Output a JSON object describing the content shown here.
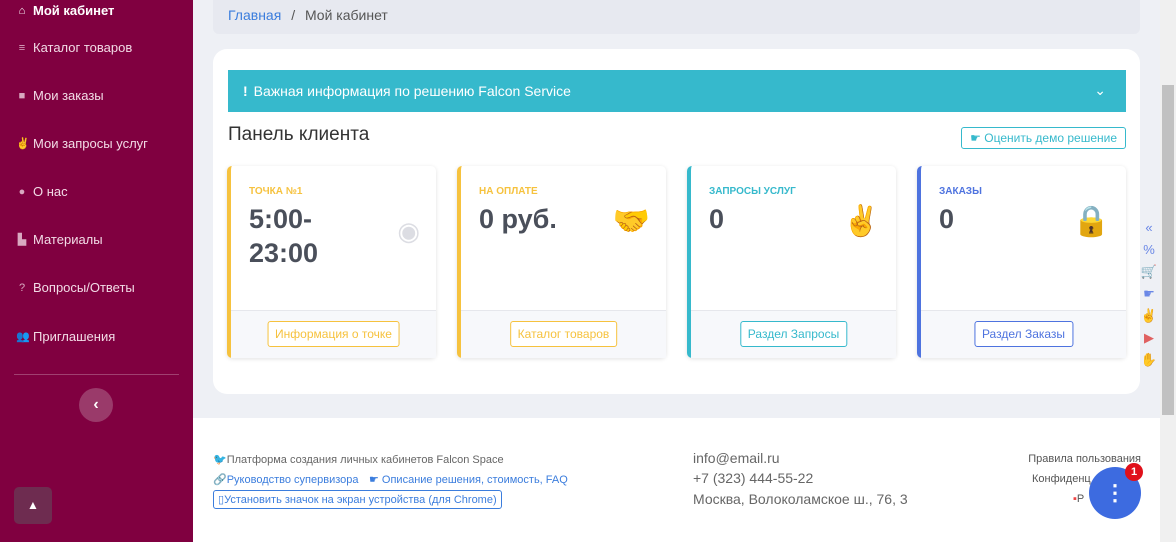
{
  "sidebar": {
    "items": [
      {
        "label": "Мой кабинет",
        "icon": "home-icon"
      },
      {
        "label": "Каталог товаров",
        "icon": "list-icon"
      },
      {
        "label": "Мои заказы",
        "icon": "bag-icon"
      },
      {
        "label": "Мои запросы услуг",
        "icon": "hand-peace-icon"
      },
      {
        "label": "О нас",
        "icon": "info-icon"
      },
      {
        "label": "Материалы",
        "icon": "materials-icon"
      },
      {
        "label": "Вопросы/Ответы",
        "icon": "question-icon"
      },
      {
        "label": "Приглашения",
        "icon": "users-icon"
      }
    ]
  },
  "breadcrumb": {
    "home": "Главная",
    "sep": "/",
    "current": "Мой кабинет"
  },
  "alert": {
    "text": "Важная информация по решению Falcon Service"
  },
  "panel": {
    "title": "Панель клиента",
    "rate_button": "Оценить демо решение"
  },
  "cards": [
    {
      "label": "ТОЧКА №1",
      "value": "5:00-23:00",
      "button": "Информация о точке",
      "color": "#f6c23e"
    },
    {
      "label": "НА ОПЛАТЕ",
      "value": "0 руб.",
      "button": "Каталог товаров",
      "color": "#f6c23e"
    },
    {
      "label": "ЗАПРОСЫ УСЛУГ",
      "value": "0",
      "button": "Раздел Запросы",
      "color": "#36b9cc"
    },
    {
      "label": "ЗАКАЗЫ",
      "value": "0",
      "button": "Раздел Заказы",
      "color": "#4e73df"
    }
  ],
  "footer": {
    "platform": "Платформа создания личных кабинетов Falcon Space",
    "supervisor": "Руководство супервизора",
    "description": "Описание решения, стоимость, FAQ",
    "install": "Установить значок на экран устройства (для Chrome)",
    "email": "info@email.ru",
    "phone": "+7 (323) 444-55-22",
    "address": "Москва, Волоколамское ш., 76, 3",
    "rules": "Правила пользования",
    "privacy": "Конфиденц",
    "pdf": "Р"
  },
  "chat": {
    "badge": "1"
  }
}
